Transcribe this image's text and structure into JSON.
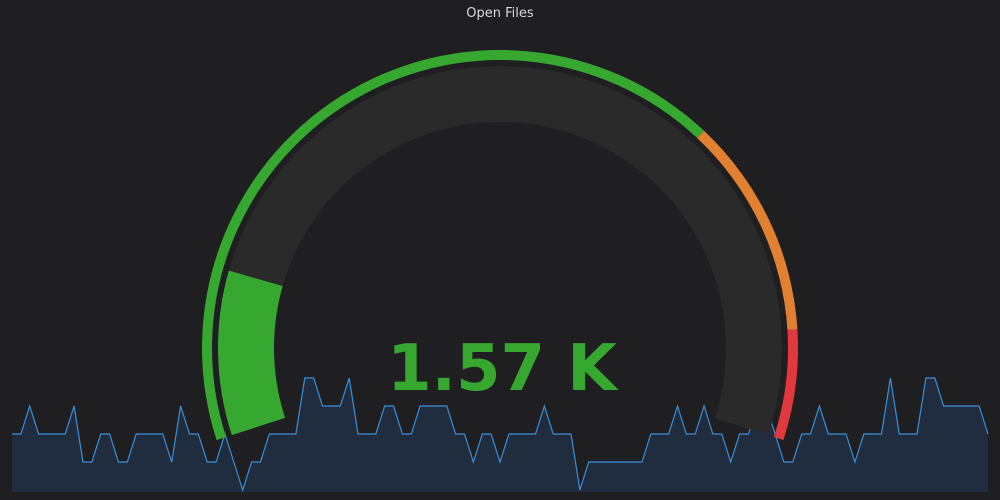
{
  "panel": {
    "title": "Open Files"
  },
  "gauge": {
    "value": 1570,
    "display": "1.57 K",
    "min": 0,
    "max": 10000,
    "color": "#37a82f",
    "thresholds": [
      {
        "from": 0,
        "to": 7000,
        "color": "#37a82f"
      },
      {
        "from": 7000,
        "to": 9000,
        "color": "#e08030"
      },
      {
        "from": 9000,
        "to": 10000,
        "color": "#e0383c"
      }
    ],
    "track_color": "#2a2a2b"
  },
  "sparkline": {
    "line_color": "#3a8fd9",
    "fill_color": "#1f2d3f",
    "values": [
      1,
      1,
      2,
      1,
      1,
      1,
      1,
      2,
      0,
      0,
      1,
      1,
      0,
      0,
      1,
      1,
      1,
      1,
      0,
      2,
      1,
      1,
      0,
      0,
      1,
      0,
      -1,
      0,
      0,
      1,
      1,
      1,
      1,
      3,
      3,
      2,
      2,
      2,
      3,
      1,
      1,
      1,
      2,
      2,
      1,
      1,
      2,
      2,
      2,
      2,
      1,
      1,
      0,
      1,
      1,
      0,
      1,
      1,
      1,
      1,
      2,
      1,
      1,
      1,
      -1,
      0,
      0,
      0,
      0,
      0,
      0,
      0,
      1,
      1,
      1,
      2,
      1,
      1,
      2,
      1,
      1,
      0,
      1,
      1,
      2,
      2,
      1,
      0,
      0,
      1,
      1,
      2,
      1,
      1,
      1,
      0,
      1,
      1,
      1,
      3,
      1,
      1,
      1,
      3,
      3,
      2,
      2,
      2,
      2,
      2,
      1
    ]
  }
}
